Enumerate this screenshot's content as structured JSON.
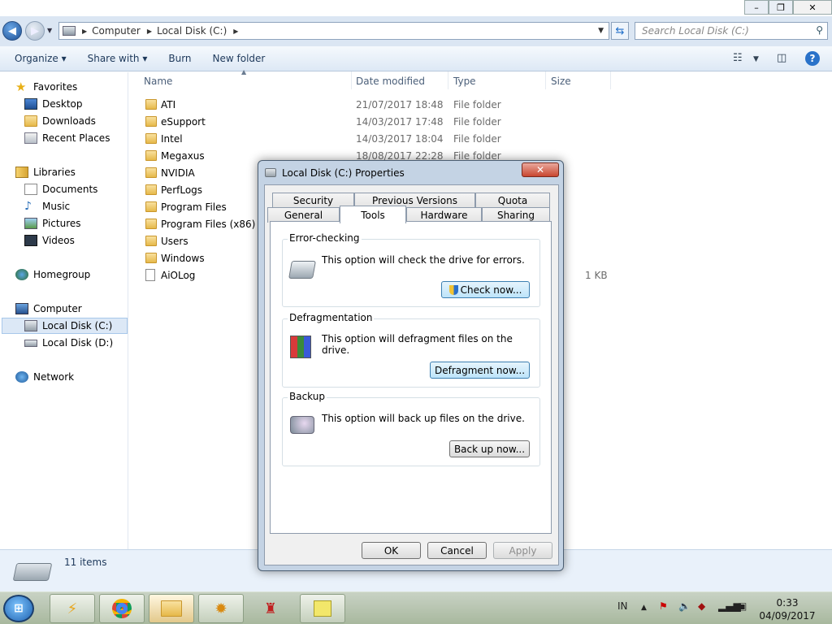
{
  "window": {
    "controls": {
      "minimize": "–",
      "maximize": "❐",
      "close": "✕"
    }
  },
  "address": {
    "segments": [
      "Computer",
      "Local Disk (C:)"
    ],
    "search_placeholder": "Search Local Disk (C:)"
  },
  "toolbar": {
    "organize": "Organize ▾",
    "share_with": "Share with ▾",
    "burn": "Burn",
    "new_folder": "New folder"
  },
  "nav": {
    "favorites": "Favorites",
    "desktop": "Desktop",
    "downloads": "Downloads",
    "recent_places": "Recent Places",
    "libraries": "Libraries",
    "documents": "Documents",
    "music": "Music",
    "pictures": "Pictures",
    "videos": "Videos",
    "homegroup": "Homegroup",
    "computer": "Computer",
    "local_c": "Local Disk (C:)",
    "local_d": "Local Disk (D:)",
    "network": "Network"
  },
  "columns": {
    "name": "Name",
    "date": "Date modified",
    "type": "Type",
    "size": "Size"
  },
  "files": [
    {
      "name": "ATI",
      "date": "21/07/2017 18:48",
      "type": "File folder",
      "size": ""
    },
    {
      "name": "eSupport",
      "date": "14/03/2017 17:48",
      "type": "File folder",
      "size": ""
    },
    {
      "name": "Intel",
      "date": "14/03/2017 18:04",
      "type": "File folder",
      "size": ""
    },
    {
      "name": "Megaxus",
      "date": "18/08/2017 22:28",
      "type": "File folder",
      "size": ""
    },
    {
      "name": "NVIDIA",
      "date": "",
      "type": "",
      "size": ""
    },
    {
      "name": "PerfLogs",
      "date": "",
      "type": "",
      "size": ""
    },
    {
      "name": "Program Files",
      "date": "",
      "type": "",
      "size": ""
    },
    {
      "name": "Program Files (x86)",
      "date": "",
      "type": "",
      "size": ""
    },
    {
      "name": "Users",
      "date": "",
      "type": "",
      "size": ""
    },
    {
      "name": "Windows",
      "date": "",
      "type": "",
      "size": ""
    },
    {
      "name": "AiOLog",
      "date": "",
      "type": "",
      "size": "1 KB"
    }
  ],
  "status": {
    "count": "11 items"
  },
  "dialog": {
    "title": "Local Disk (C:) Properties",
    "close": "✕",
    "tabs_top": [
      "Security",
      "Previous Versions",
      "Quota"
    ],
    "tabs_bottom": [
      "General",
      "Tools",
      "Hardware",
      "Sharing"
    ],
    "error_checking": {
      "label": "Error-checking",
      "text": "This option will check the drive for errors.",
      "button": "Check now..."
    },
    "defrag": {
      "label": "Defragmentation",
      "text": "This option will defragment files on the drive.",
      "button": "Defragment now..."
    },
    "backup": {
      "label": "Backup",
      "text": "This option will back up files on the drive.",
      "button": "Back up now..."
    },
    "ok": "OK",
    "cancel": "Cancel",
    "apply": "Apply"
  },
  "taskbar": {
    "lang": "IN",
    "time": "0:33",
    "date": "04/09/2017"
  }
}
